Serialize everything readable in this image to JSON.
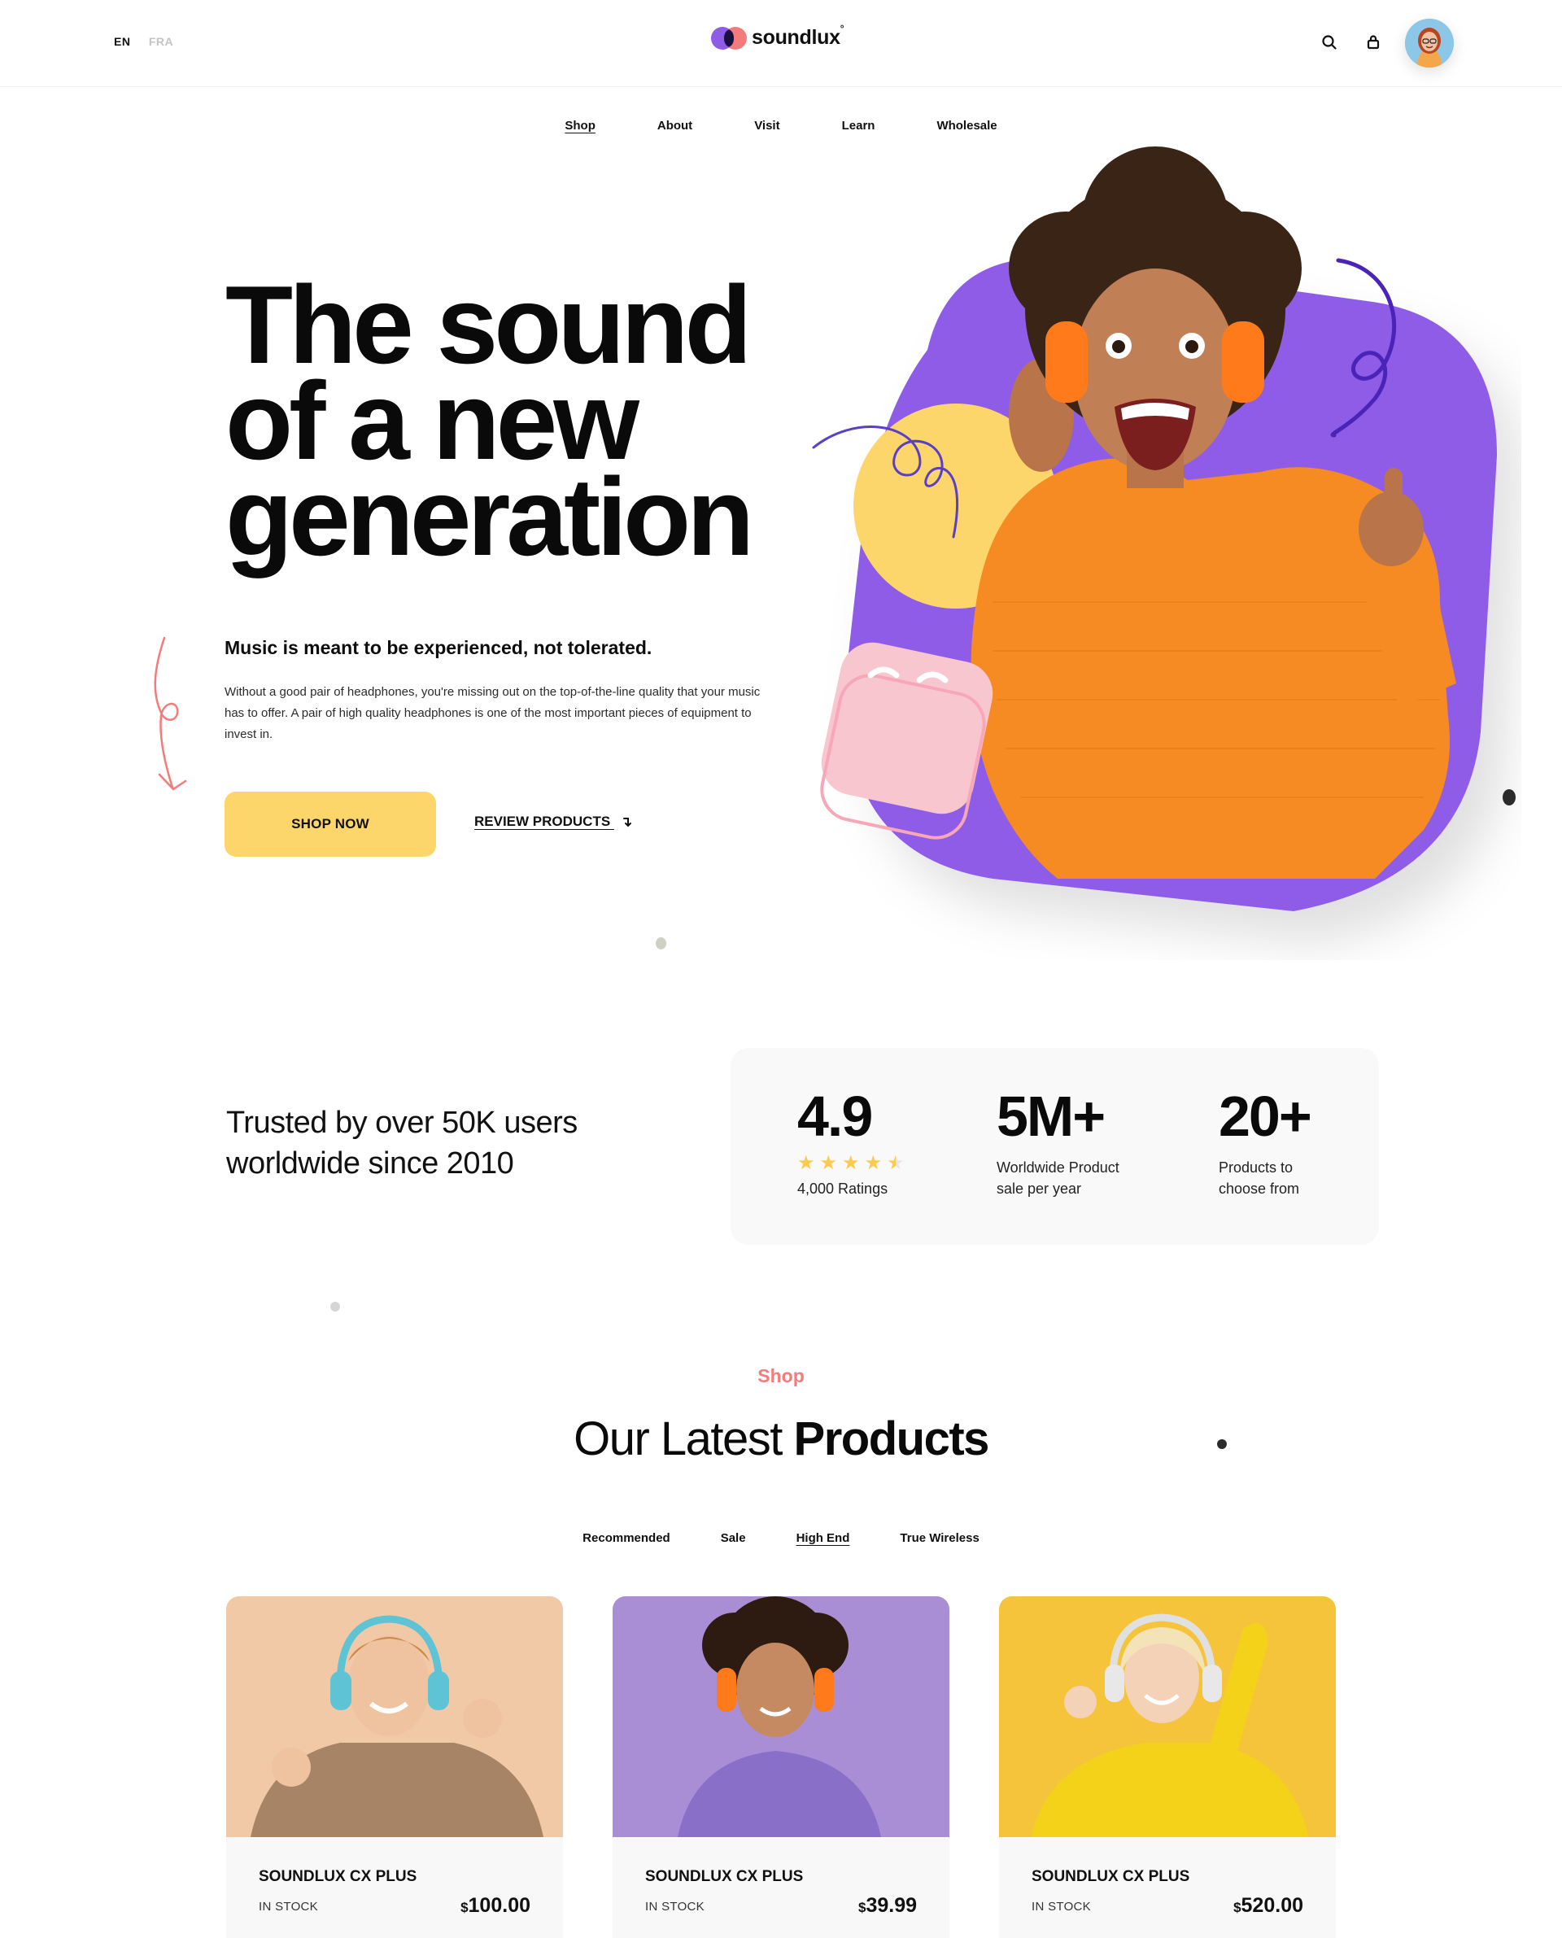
{
  "header": {
    "lang_active": "EN",
    "lang_inactive": "FRA",
    "brand": "soundlux",
    "brand_mark": "°"
  },
  "nav": {
    "items": [
      "Shop",
      "About",
      "Visit",
      "Learn",
      "Wholesale"
    ],
    "active": "Shop"
  },
  "hero": {
    "title_lines": [
      "The sound",
      "of a new",
      "generation"
    ],
    "subtitle": "Music is meant to be experienced, not tolerated.",
    "body": "Without a good pair of headphones, you're missing out on the top-of-the-line quality that your music has to offer. A pair of high quality headphones is one of the most important pieces of equipment to invest in.",
    "cta_primary": "SHOP NOW",
    "cta_secondary": "REVIEW PRODUCTS",
    "cta_secondary_icon": "arrow-down-right-icon"
  },
  "trust": {
    "headline_lines": [
      "Trusted by over 50K users",
      "worldwide since 2010"
    ],
    "stats": [
      {
        "value": "4.9",
        "label": "4,000 Ratings",
        "rating": 4.5
      },
      {
        "value": "5M+",
        "label_lines": [
          "Worldwide Product",
          "sale per year"
        ]
      },
      {
        "value": "20+",
        "label_lines": [
          "Products to",
          "choose from"
        ]
      }
    ]
  },
  "products": {
    "eyebrow": "Shop",
    "title_light": "Our Latest",
    "title_bold": "Products",
    "filters": [
      "Recommended",
      "Sale",
      "High End",
      "True Wireless"
    ],
    "active_filter": "High End",
    "items": [
      {
        "name": "SOUNDLUX CX PLUS",
        "stock": "IN STOCK",
        "currency": "$",
        "price": "100.00",
        "bg": "#f2c9a6"
      },
      {
        "name": "SOUNDLUX CX PLUS",
        "stock": "IN STOCK",
        "currency": "$",
        "price": "39.99",
        "bg": "#a98ed6"
      },
      {
        "name": "SOUNDLUX CX PLUS",
        "stock": "IN STOCK",
        "currency": "$",
        "price": "520.00",
        "bg": "#f5c43a"
      }
    ]
  },
  "colors": {
    "accent_yellow": "#fdd66b",
    "accent_purple": "#8e5ce6",
    "accent_coral": "#f47b7b",
    "accent_pink": "#f8c6cf"
  }
}
